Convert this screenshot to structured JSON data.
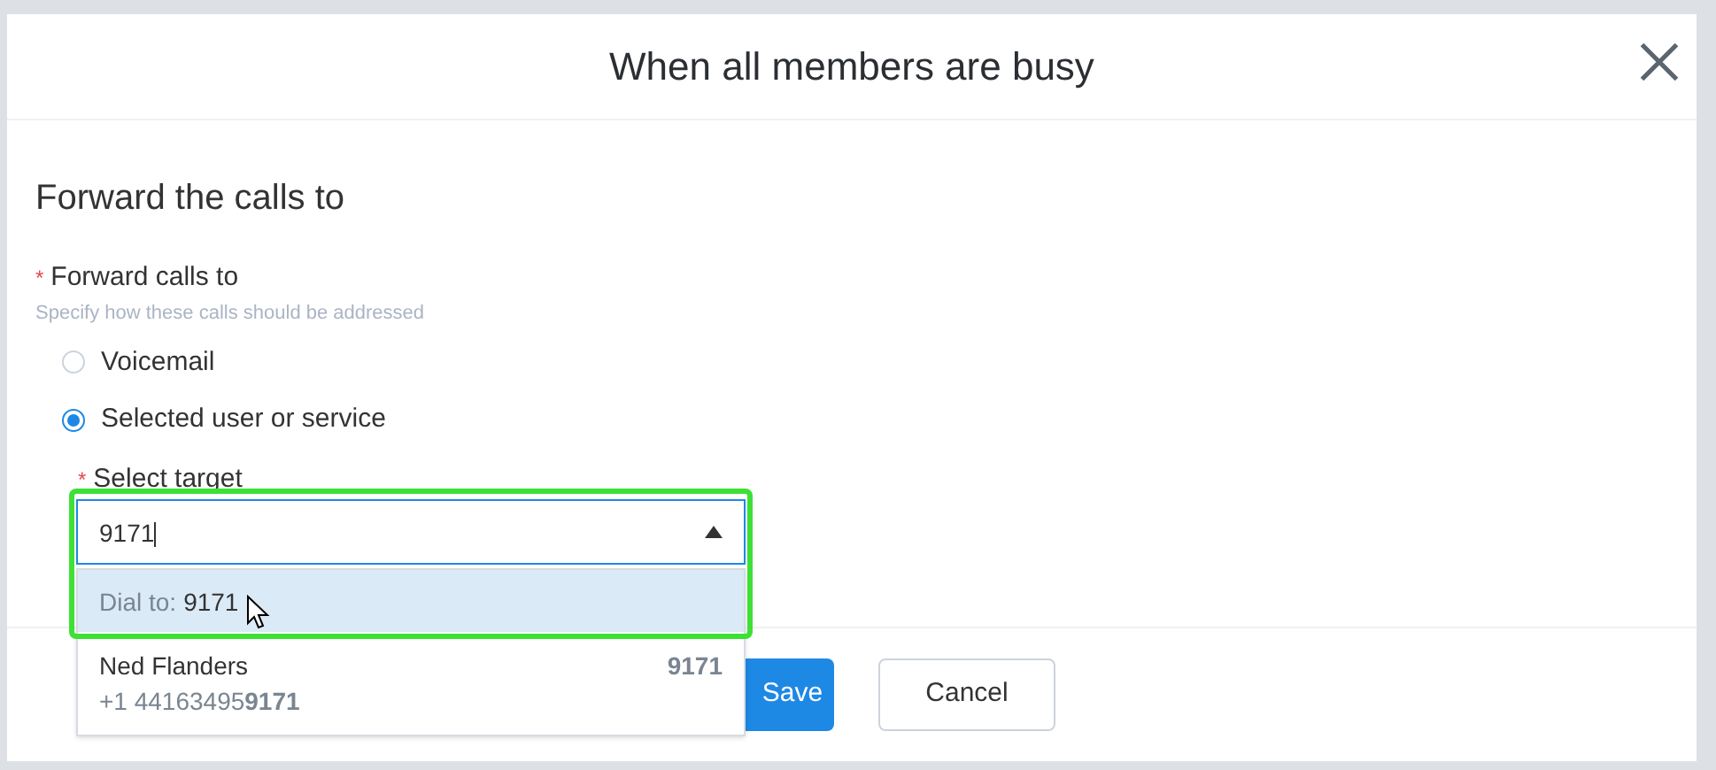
{
  "dialog": {
    "title": "When all members are busy"
  },
  "section": {
    "heading": "Forward the calls to"
  },
  "field": {
    "label": "Forward calls to",
    "required": true,
    "required_mark": "*",
    "hint": "Specify how these calls should be addressed"
  },
  "options": [
    {
      "label": "Voicemail",
      "selected": false
    },
    {
      "label": "Selected user or service",
      "selected": true
    }
  ],
  "target": {
    "label": "Select target",
    "required": true,
    "required_mark": "*",
    "value": "9171",
    "expanded": true
  },
  "dropdown": [
    {
      "kind": "dial",
      "prefix": "Dial to:",
      "number": "9171",
      "highlighted": true
    },
    {
      "kind": "contact",
      "name": "Ned Flanders",
      "extension": "9171",
      "phone": "+1 44163495**9171**",
      "highlighted": false
    }
  ],
  "buttons": [
    {
      "label": "Save",
      "kind": "primary"
    },
    {
      "label": "Cancel",
      "kind": "secondary"
    }
  ]
}
